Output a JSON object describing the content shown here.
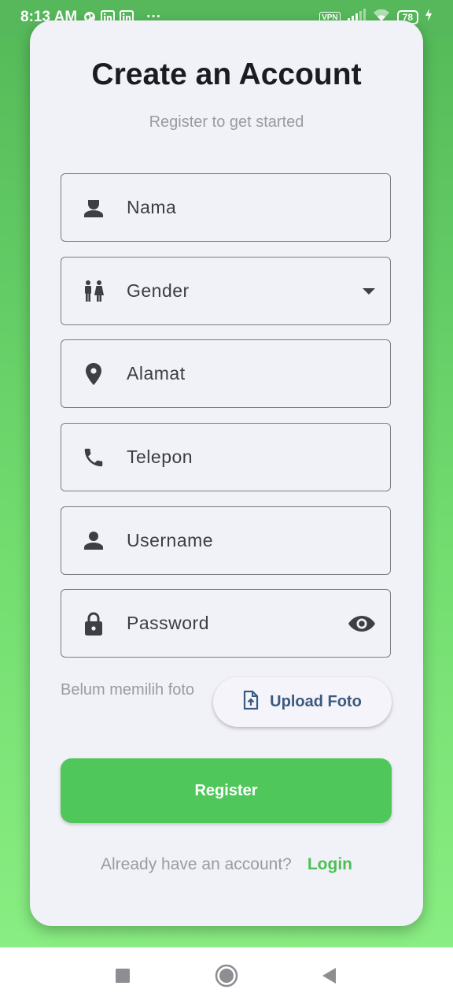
{
  "status_bar": {
    "time": "8:13 AM",
    "vpn": "VPN",
    "battery": "78",
    "more": "···"
  },
  "header": {
    "title": "Create an Account",
    "subtitle": "Register to get started"
  },
  "fields": {
    "nama": {
      "label": "Nama",
      "icon": "person-icon"
    },
    "gender": {
      "label": "Gender",
      "icon": "wc-icon"
    },
    "alamat": {
      "label": "Alamat",
      "icon": "location-pin-icon"
    },
    "telepon": {
      "label": "Telepon",
      "icon": "phone-icon"
    },
    "username": {
      "label": "Username",
      "icon": "person-icon"
    },
    "password": {
      "label": "Password",
      "icon": "lock-icon"
    }
  },
  "photo": {
    "status": "Belum memilih foto",
    "upload_label": "Upload Foto"
  },
  "actions": {
    "register_label": "Register"
  },
  "footer": {
    "prompt": "Already have an account?",
    "login_label": "Login"
  },
  "colors": {
    "accent_green": "#50c75a",
    "card_bg": "#f1f1f8",
    "upload_text": "#3a5a80"
  }
}
